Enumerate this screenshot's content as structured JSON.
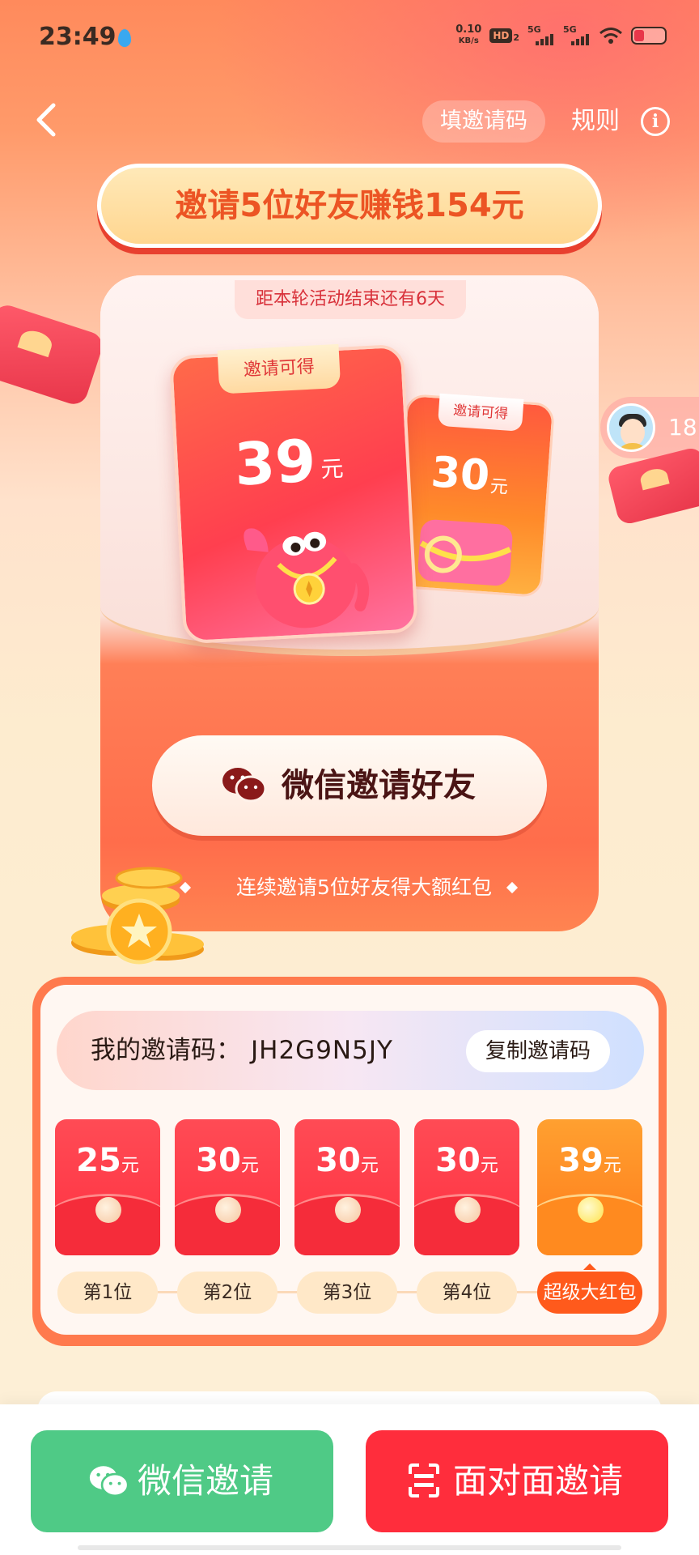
{
  "status_bar": {
    "time": "23:49",
    "net_speed_value": "0.10",
    "net_speed_unit": "KB/s",
    "hd_badge": "HD",
    "hd_sub": "2",
    "signal_1": "5G",
    "signal_2": "5G"
  },
  "nav": {
    "fill_code": "填邀请码",
    "rules": "规则",
    "info_glyph": "i"
  },
  "headline": "邀请5位好友赚钱154元",
  "countdown": "距本轮活动结束还有6天",
  "reward_cards": {
    "main": {
      "tag": "邀请可得",
      "amount": "39",
      "unit": "元"
    },
    "next": {
      "tag": "邀请可得",
      "amount": "30",
      "unit": "元"
    }
  },
  "ticker": {
    "text": "18"
  },
  "main_button": "微信邀请好友",
  "streak_text": "连续邀请5位好友得大额红包",
  "invite_code": {
    "label": "我的邀请码：",
    "value": "JH2G9N5JY",
    "copy_label": "复制邀请码"
  },
  "envelopes": [
    {
      "amount": "25",
      "unit": "元",
      "position": "第1位",
      "super": false
    },
    {
      "amount": "30",
      "unit": "元",
      "position": "第2位",
      "super": false
    },
    {
      "amount": "30",
      "unit": "元",
      "position": "第3位",
      "super": false
    },
    {
      "amount": "30",
      "unit": "元",
      "position": "第4位",
      "super": false
    },
    {
      "amount": "39",
      "unit": "元",
      "position": "超级大红包",
      "super": true
    }
  ],
  "bottom": {
    "wechat_invite": "微信邀请",
    "face_to_face": "面对面邀请"
  },
  "colors": {
    "wechat_green": "#4fca86",
    "primary_red": "#ff2d3c",
    "accent_orange": "#ff7a4d",
    "headline_text": "#ec5424"
  },
  "icons": [
    "back-arrow-icon",
    "info-icon",
    "wechat-icon",
    "scan-icon"
  ]
}
